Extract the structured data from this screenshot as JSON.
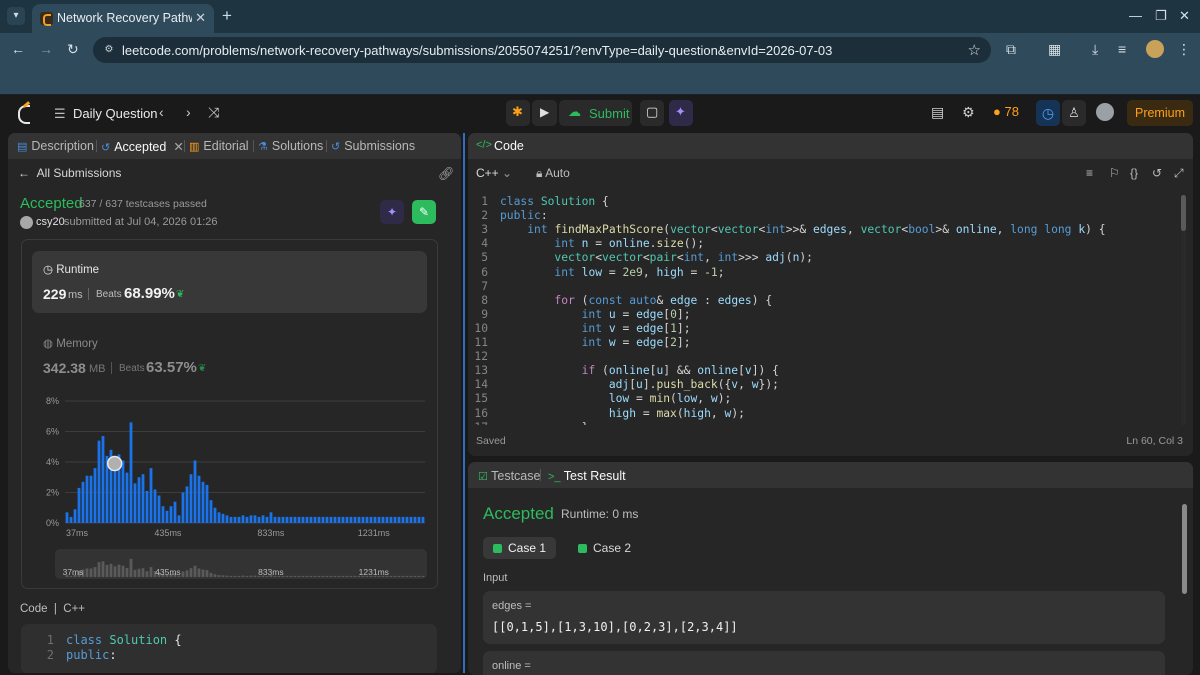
{
  "browser": {
    "tab_title": "Network Recovery Pathways - LeetCode",
    "url": "leetcode.com/problems/network-recovery-pathways/submissions/2055074251/?envType=daily-question&envId=2026-07-03"
  },
  "topbar": {
    "daily_label": "Daily Question",
    "submit_label": "Submit",
    "streak": "78",
    "premium_label": "Premium"
  },
  "left": {
    "tabs": [
      "Description",
      "Accepted",
      "Editorial",
      "Solutions",
      "Submissions"
    ],
    "back_label": "All Submissions",
    "status": "Accepted",
    "testcases": "637 / 637 testcases passed",
    "user": "csy20",
    "submitted_at": "submitted at Jul 04, 2026 01:26",
    "runtime": {
      "label": "Runtime",
      "value": "229",
      "unit": "ms",
      "beats_label": "Beats",
      "beats": "68.99%"
    },
    "memory": {
      "label": "Memory",
      "value": "342.38",
      "unit": "MB",
      "beats_label": "Beats",
      "beats": "63.57%"
    },
    "code_label": "Code",
    "code_lang": "C++",
    "code_preview": [
      "class Solution {",
      "public:"
    ]
  },
  "chart_data": {
    "type": "bar",
    "y_ticks": [
      "8%",
      "6%",
      "4%",
      "2%",
      "0%"
    ],
    "ylim": [
      0,
      8
    ],
    "x_ticks": [
      "37ms",
      "435ms",
      "833ms",
      "1231ms"
    ],
    "xlim": [
      37,
      1429
    ],
    "user_runtime_ms": 229,
    "accent_color": "#1a73e8",
    "values": [
      0.7,
      0.4,
      0.9,
      2.3,
      2.7,
      3.1,
      3.1,
      3.6,
      5.4,
      5.7,
      4.4,
      4.8,
      3.9,
      4.5,
      4.1,
      3.3,
      6.6,
      2.6,
      3.0,
      3.2,
      2.1,
      3.6,
      2.2,
      1.8,
      1.1,
      0.8,
      1.1,
      1.4,
      0.5,
      2.0,
      2.4,
      3.2,
      4.1,
      3.1,
      2.7,
      2.5,
      1.5,
      1.0,
      0.7,
      0.6,
      0.5,
      0.4,
      0.4,
      0.4,
      0.5,
      0.4,
      0.5,
      0.5,
      0.4,
      0.5,
      0.4,
      0.7,
      0.4,
      0.4,
      0.4,
      0.4,
      0.4,
      0.4,
      0.4,
      0.4,
      0.4,
      0.4,
      0.4,
      0.4,
      0.4,
      0.4,
      0.4,
      0.4,
      0.4,
      0.4,
      0.4,
      0.4,
      0.4,
      0.4,
      0.4,
      0.4,
      0.4,
      0.4,
      0.4,
      0.4,
      0.4,
      0.4,
      0.4,
      0.4,
      0.4,
      0.4,
      0.4,
      0.4,
      0.4,
      0.4
    ]
  },
  "code": {
    "title": "Code",
    "lang": "C++",
    "mode": "Auto",
    "status": "Saved",
    "position": "Ln 60, Col 3",
    "lines": [
      "class Solution {",
      "public:",
      "    int findMaxPathScore(vector<vector<int>>& edges, vector<bool>& online, long long k) {",
      "        int n = online.size();",
      "        vector<vector<pair<int, int>>> adj(n);",
      "        int low = 2e9, high = -1;",
      "",
      "        for (const auto& edge : edges) {",
      "            int u = edge[0];",
      "            int v = edge[1];",
      "            int w = edge[2];",
      "",
      "            if (online[u] && online[v]) {",
      "                adj[u].push_back({v, w});",
      "                low = min(low, w);",
      "                high = max(high, w);",
      "            }"
    ]
  },
  "result": {
    "tabs": [
      "Testcase",
      "Test Result"
    ],
    "status": "Accepted",
    "runtime": "Runtime: 0 ms",
    "cases": [
      "Case 1",
      "Case 2"
    ],
    "input_label": "Input",
    "inputs": [
      {
        "name": "edges =",
        "value": "[[0,1,5],[1,3,10],[0,2,3],[2,3,4]]"
      },
      {
        "name": "online =",
        "value": ""
      }
    ]
  }
}
